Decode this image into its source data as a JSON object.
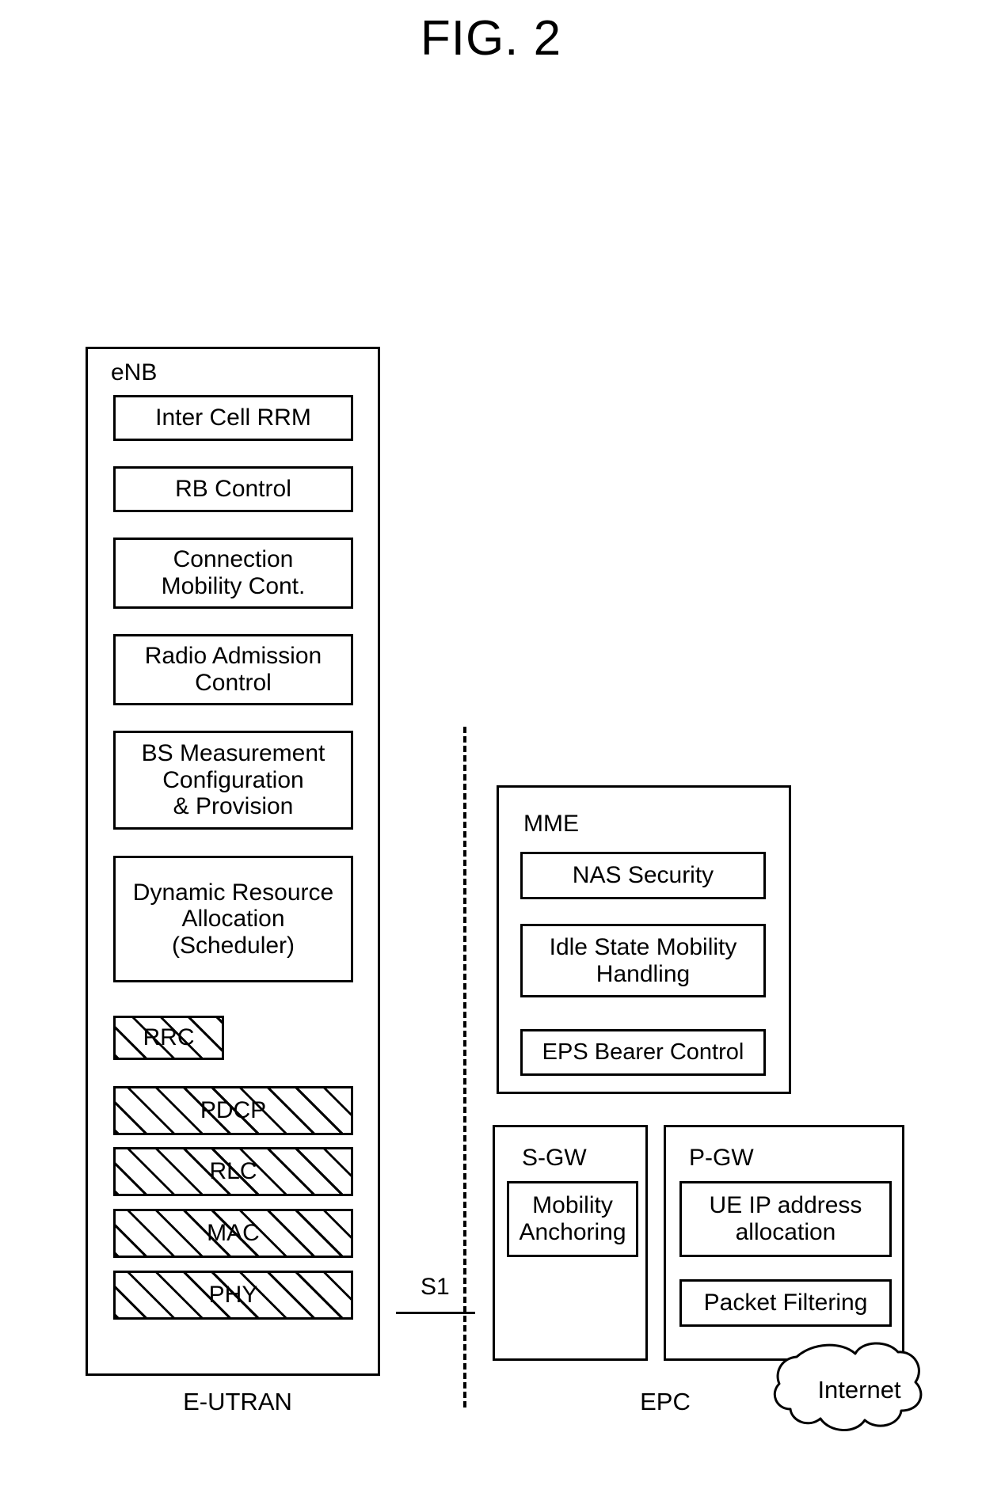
{
  "figure": {
    "title": "FIG. 2"
  },
  "enb": {
    "label": "eNB",
    "functions": [
      {
        "name": "inter-cell-rrm",
        "label": "Inter Cell RRM"
      },
      {
        "name": "rb-control",
        "label": "RB Control"
      },
      {
        "name": "connection-mobility-control",
        "label": "Connection\nMobility Cont."
      },
      {
        "name": "radio-admission-control",
        "label": "Radio Admission\nControl"
      },
      {
        "name": "bs-measurement-configuration",
        "label": "BS Measurement\nConfiguration\n& Provision"
      },
      {
        "name": "dynamic-resource-allocation",
        "label": "Dynamic Resource\nAllocation\n(Scheduler)"
      }
    ],
    "protocol_stack": [
      {
        "name": "rrc",
        "label": "RRC"
      },
      {
        "name": "pdcp",
        "label": "PDCP"
      },
      {
        "name": "rlc",
        "label": "RLC"
      },
      {
        "name": "mac",
        "label": "MAC"
      },
      {
        "name": "phy",
        "label": "PHY"
      }
    ]
  },
  "mme": {
    "label": "MME",
    "functions": [
      {
        "name": "nas-security",
        "label": "NAS Security"
      },
      {
        "name": "idle-state-mobility-handling",
        "label": "Idle State Mobility\nHandling"
      },
      {
        "name": "eps-bearer-control",
        "label": "EPS Bearer Control"
      }
    ]
  },
  "sgw": {
    "label": "S-GW",
    "functions": [
      {
        "name": "mobility-anchoring",
        "label": "Mobility\nAnchoring"
      }
    ]
  },
  "pgw": {
    "label": "P-GW",
    "functions": [
      {
        "name": "ue-ip-address-allocation",
        "label": "UE IP address\nallocation"
      },
      {
        "name": "packet-filtering",
        "label": "Packet Filtering"
      }
    ]
  },
  "interface": {
    "s1_label": "S1"
  },
  "internet": {
    "label": "Internet"
  },
  "captions": {
    "left": "E-UTRAN",
    "right": "EPC"
  },
  "colors": {
    "stroke": "#000000",
    "background": "#ffffff"
  }
}
